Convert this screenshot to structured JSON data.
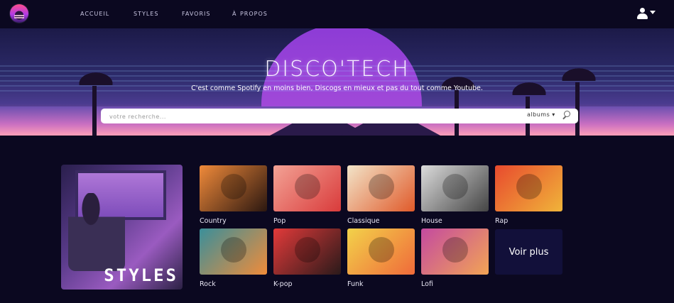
{
  "nav": {
    "links": [
      "Accueil",
      "styles",
      "favoris",
      "À propos"
    ]
  },
  "hero": {
    "title": "DISCO'TECH",
    "subtitle": "C'est comme Spotify en moins bien, Discogs en mieux et pas du tout comme Youtube.",
    "search": {
      "placeholder": "votre recherche...",
      "type": "albums"
    }
  },
  "styles_section": {
    "title": "STYLES",
    "genres": [
      {
        "label": "Country",
        "color1": "#f08a3a",
        "color2": "#2b1710"
      },
      {
        "label": "Pop",
        "color1": "#f3a295",
        "color2": "#d93b3b"
      },
      {
        "label": "Classique",
        "color1": "#f2e4c9",
        "color2": "#e05a2a"
      },
      {
        "label": "House",
        "color1": "#dcdcdc",
        "color2": "#444444"
      },
      {
        "label": "Rap",
        "color1": "#e84a2e",
        "color2": "#f0b43a"
      },
      {
        "label": "Rock",
        "color1": "#3a8f9a",
        "color2": "#f08c3a"
      },
      {
        "label": "K-pop",
        "color1": "#e23a3a",
        "color2": "#2a1a1a"
      },
      {
        "label": "Funk",
        "color1": "#f2d24a",
        "color2": "#f06a3a"
      },
      {
        "label": "Lofi",
        "color1": "#c44aa0",
        "color2": "#f2a455"
      }
    ],
    "more_label": "Voir plus"
  },
  "colors": {
    "background": "#0b0820",
    "accent": "#a24ad8"
  }
}
